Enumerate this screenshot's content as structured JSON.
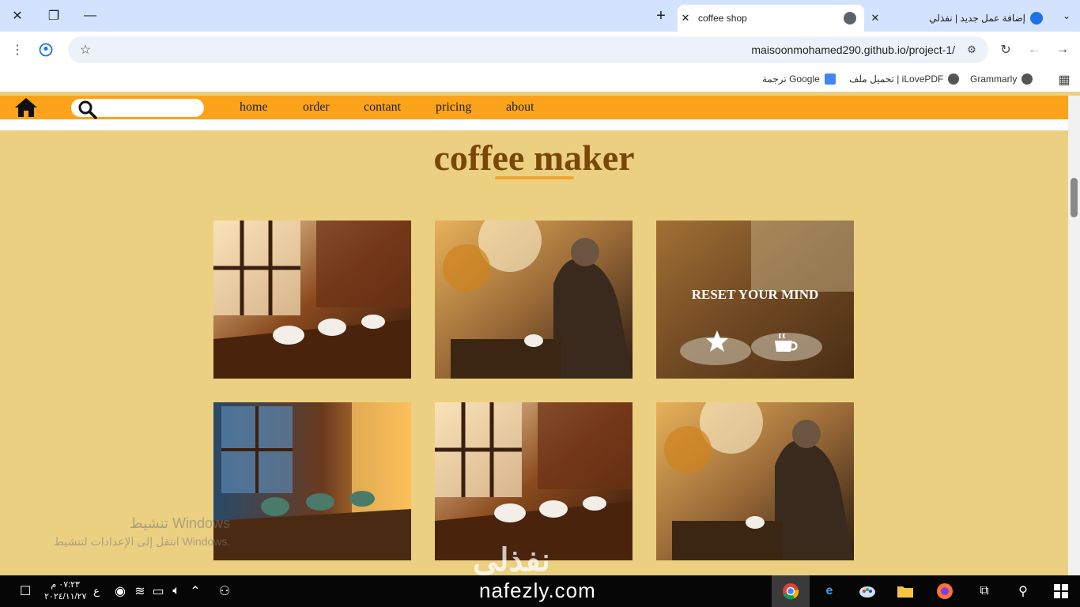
{
  "browser": {
    "tabs": [
      {
        "title": "coffee shop",
        "active": true
      },
      {
        "title": "إضافة عمل جديد | نفذلي",
        "active": false
      }
    ],
    "url": "maisoonmohamed290.github.io/project-1/",
    "bookmarks": [
      {
        "label": "Grammarly"
      },
      {
        "label": "تحميل ملف | iLovePDF"
      },
      {
        "label": "ترجمة Google"
      }
    ]
  },
  "site": {
    "nav": {
      "links": [
        "home",
        "order",
        "contant",
        "pricing",
        "about"
      ],
      "search_placeholder": ""
    },
    "heading": "coffee maker",
    "gallery": {
      "overlay_text": "RESET YOUR MIND",
      "images": [
        {
          "alt": "coffee cups on table by window"
        },
        {
          "alt": "person reading at cafe table"
        },
        {
          "alt": "reset your mind coffee and pastries"
        },
        {
          "alt": "winter window with coffee cups"
        },
        {
          "alt": "coffee cups on table by window"
        },
        {
          "alt": "person reading at cafe table"
        }
      ]
    }
  },
  "os": {
    "activation_title": "تنشيط Windows",
    "activation_sub": "انتقل إلى الإعدادات لتنشيط Windows.",
    "watermark_ar": "نفذلي",
    "watermark_en": "nafezly.com",
    "clock_time": "٠٧:٢٣ م",
    "clock_date": "٢٠٢٤/١١/٢٧",
    "lang": "ع"
  },
  "colors": {
    "navbar": "#faa31b",
    "page_bg": "#ebd082",
    "heading": "#7a4708",
    "underline": "#f0a533"
  }
}
